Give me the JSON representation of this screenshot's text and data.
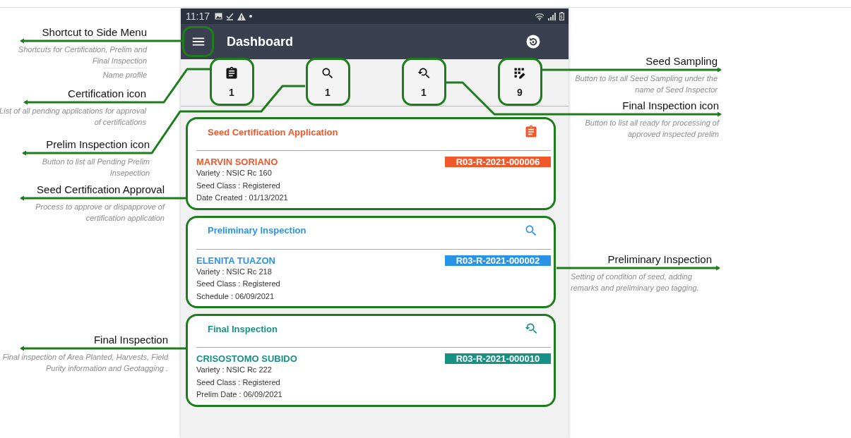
{
  "status_bar": {
    "time": "11:17"
  },
  "app_bar": {
    "title": "Dashboard"
  },
  "shortcuts": [
    {
      "kind": "certification",
      "count": "1"
    },
    {
      "kind": "prelim",
      "count": "1"
    },
    {
      "kind": "final",
      "count": "1"
    },
    {
      "kind": "sampling",
      "count": "9"
    }
  ],
  "cards": [
    {
      "kind": "certification",
      "title": "Seed Certification Application",
      "name": "MARVIN SORIANO",
      "code": "R03-R-2021-000006",
      "color": "#f0582a",
      "details": [
        "Variety : NSIC Rc 160",
        "Seed Class : Registered",
        "Date Created : 01/13/2021"
      ]
    },
    {
      "kind": "prelim",
      "title": "Preliminary Inspection",
      "name": "ELENITA TUAZON",
      "code": "R03-R-2021-000002",
      "color": "#2b93e6",
      "details": [
        "Variety : NSIC Rc 218",
        "Seed Class : Registered",
        "Schedule : 06/09/2021"
      ]
    },
    {
      "kind": "final",
      "title": "Final Inspection",
      "name": "CRISOSTOMO SUBIDO",
      "code": "R03-R-2021-000010",
      "color": "#179184",
      "details": [
        "Variety : NSIC Rc 222",
        "Seed Class : Registered",
        "Prelim Date : 06/09/2021"
      ]
    }
  ],
  "annotations": [
    {
      "title": "Shortcut to Side Menu",
      "notes": [
        "Shortcuts for Certification, Prelim and Final Inspection",
        "Name profile"
      ]
    },
    {
      "title": "Certification icon",
      "notes": [
        "List of all pending applications for approval of certifications"
      ]
    },
    {
      "title": "Prelim Inspection icon",
      "notes": [
        "Button to list all Pending Prelim Insepection"
      ]
    },
    {
      "title": "Seed Certification Approval",
      "notes": [
        "Process to approve or dispapprove of certification application"
      ]
    },
    {
      "title": "Final Inspection",
      "notes": [
        "Final inspection of Area Planted, Harvests, Field Purity information and Geotagging ."
      ]
    },
    {
      "title": "Seed Sampling",
      "notes": [
        "Button to list all Seed Sampling under the name of Seed Inspector"
      ]
    },
    {
      "title": "Final Inspection icon",
      "notes": [
        "Button to list all ready for processing of approved inspected prelim"
      ]
    },
    {
      "title": "Preliminary Inspection",
      "notes": [
        "Setting of condition of seed, adding remarks and preliminary geo tagging."
      ]
    }
  ]
}
